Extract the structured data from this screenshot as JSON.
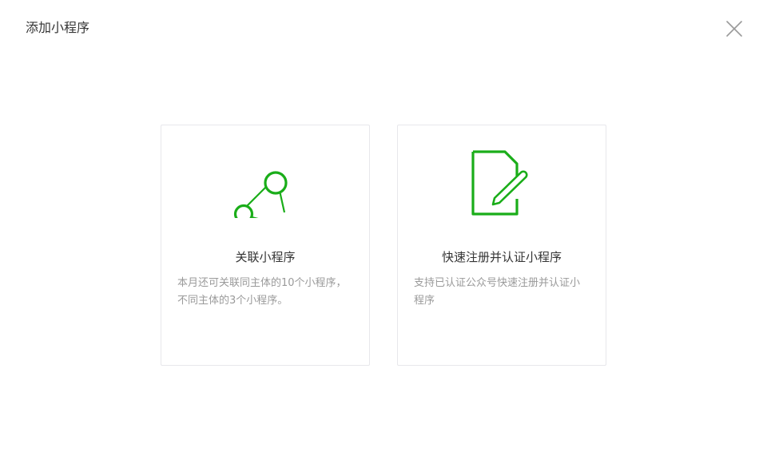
{
  "dialog": {
    "title": "添加小程序",
    "close_icon": "close-icon"
  },
  "cards": [
    {
      "icon": "link-nodes-icon",
      "title": "关联小程序",
      "description": "本月还可关联同主体的10个小程序，不同主体的3个小程序。"
    },
    {
      "icon": "document-pen-icon",
      "title": "快速注册并认证小程序",
      "description": "支持已认证公众号快速注册并认证小程序"
    }
  ],
  "colors": {
    "accent": "#1aad19",
    "border": "#e7e7eb",
    "title_text": "#353535",
    "desc_text": "#9a9a9a",
    "close_icon": "#9a9a9a"
  }
}
